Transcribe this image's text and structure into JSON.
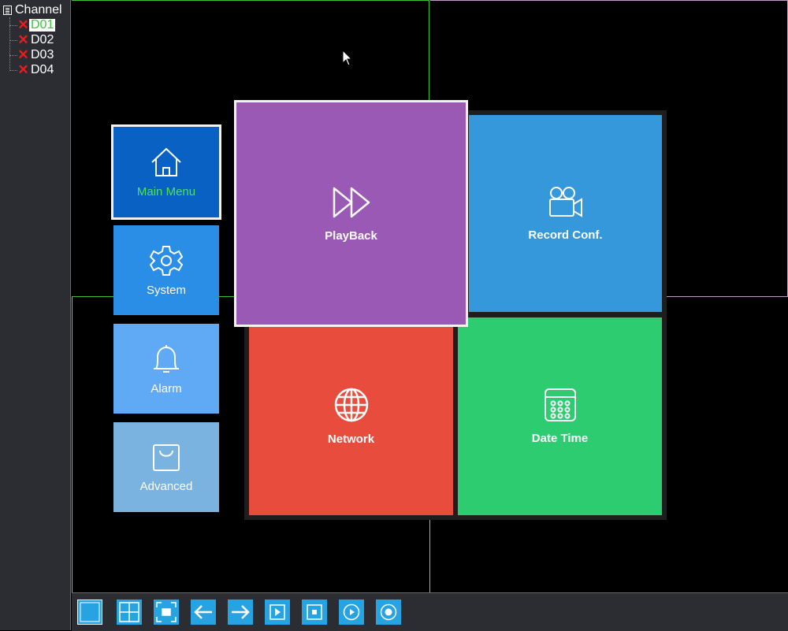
{
  "sidebar": {
    "title": "Channel",
    "channels": [
      {
        "label": "D01",
        "selected": true
      },
      {
        "label": "D02",
        "selected": false
      },
      {
        "label": "D03",
        "selected": false
      },
      {
        "label": "D04",
        "selected": false
      }
    ]
  },
  "menu": {
    "main_menu": {
      "label": "Main Menu",
      "icon": "home-icon",
      "color": "#0a61c4",
      "label_color": "#4de54d"
    },
    "system": {
      "label": "System",
      "icon": "gear-icon",
      "color": "#2a8de6"
    },
    "alarm": {
      "label": "Alarm",
      "icon": "bell-icon",
      "color": "#60a9f5"
    },
    "advanced": {
      "label": "Advanced",
      "icon": "bag-icon",
      "color": "#7ab2e0"
    },
    "playback": {
      "label": "PlayBack",
      "icon": "fast-forward-icon",
      "color": "#9b59b6"
    },
    "record_conf": {
      "label": "Record Conf.",
      "icon": "video-camera-icon",
      "color": "#3498db"
    },
    "network": {
      "label": "Network",
      "icon": "globe-icon",
      "color": "#e74c3c"
    },
    "date_time": {
      "label": "Date Time",
      "icon": "calendar-icon",
      "color": "#2ecc71"
    }
  },
  "toolbar": {
    "buttons": [
      {
        "name": "single-view-button",
        "icon": "single-square-icon"
      },
      {
        "name": "quad-view-button",
        "icon": "quad-grid-icon"
      },
      {
        "name": "fullscreen-button",
        "icon": "fullscreen-icon"
      },
      {
        "name": "previous-button",
        "icon": "arrow-left-icon"
      },
      {
        "name": "next-button",
        "icon": "arrow-right-icon"
      },
      {
        "name": "play-button",
        "icon": "play-icon"
      },
      {
        "name": "stop-button",
        "icon": "stop-icon"
      },
      {
        "name": "playback-button",
        "icon": "circle-play-icon"
      },
      {
        "name": "record-button",
        "icon": "record-icon"
      }
    ]
  }
}
